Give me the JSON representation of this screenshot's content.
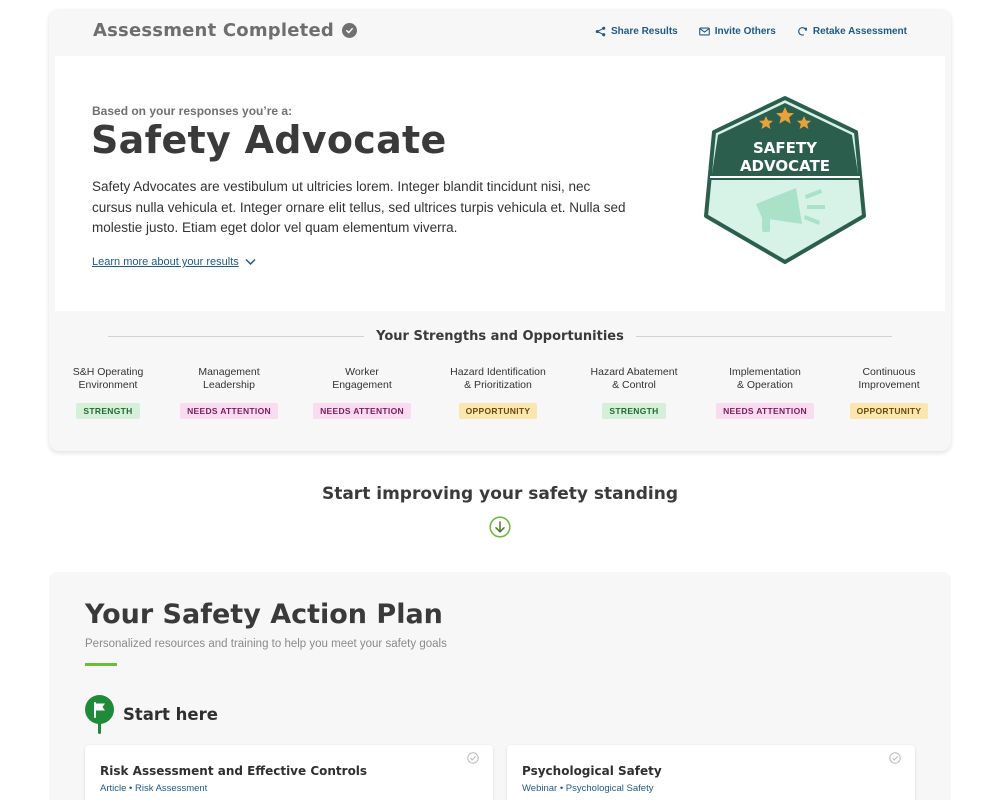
{
  "header": {
    "title": "Assessment Completed",
    "actions": [
      {
        "label": "Share Results",
        "icon": "share-icon"
      },
      {
        "label": "Invite Others",
        "icon": "mail-icon"
      },
      {
        "label": "Retake Assessment",
        "icon": "retake-icon"
      }
    ]
  },
  "hero": {
    "intro": "Based on your responses you’re a:",
    "title": "Safety Advocate",
    "description": "Safety Advocates are vestibulum ut ultricies lorem. Integer blandit tincidunt nisi, nec cursus nulla vehicula et. Integer ornare elit tellus, sed ultrices turpis vehicula et. Nulla sed molestie justo. Etiam eget dolor vel quam elementum viverra.",
    "learn_more": "Learn more about your results",
    "badge": {
      "line1": "SAFETY",
      "line2": "ADVOCATE",
      "icon": "megaphone-icon",
      "primary_color": "#2c5e4e",
      "fill_color": "#d7f2e6"
    }
  },
  "strengths": {
    "heading": "Your Strengths and Opportunities",
    "categories": [
      {
        "name_line1": "S&H Operating",
        "name_line2": "Environment",
        "status": "STRENGTH"
      },
      {
        "name_line1": "Management",
        "name_line2": "Leadership",
        "status": "NEEDS ATTENTION"
      },
      {
        "name_line1": "Worker",
        "name_line2": "Engagement",
        "status": "NEEDS ATTENTION"
      },
      {
        "name_line1": "Hazard Identification",
        "name_line2": "& Prioritization",
        "status": "OPPORTUNITY"
      },
      {
        "name_line1": "Hazard Abatement",
        "name_line2": "& Control",
        "status": "STRENGTH"
      },
      {
        "name_line1": "Implementation",
        "name_line2": "& Operation",
        "status": "NEEDS ATTENTION"
      },
      {
        "name_line1": "Continuous",
        "name_line2": "Improvement",
        "status": "OPPORTUNITY"
      }
    ]
  },
  "cta": {
    "heading": "Start improving your safety standing"
  },
  "plan": {
    "title": "Your Safety Action Plan",
    "subtitle": "Personalized resources and training to help you meet your safety goals",
    "start_here": "Start here",
    "cards": [
      {
        "title": "Risk Assessment and Effective Controls",
        "meta": "Article • Risk Assessment"
      },
      {
        "title": "Psychological Safety",
        "meta": "Webinar • Psychological Safety"
      }
    ]
  },
  "colors": {
    "link": "#1d5a8a",
    "accent_green": "#6cbb3c",
    "flag_green": "#1f8a3a"
  }
}
